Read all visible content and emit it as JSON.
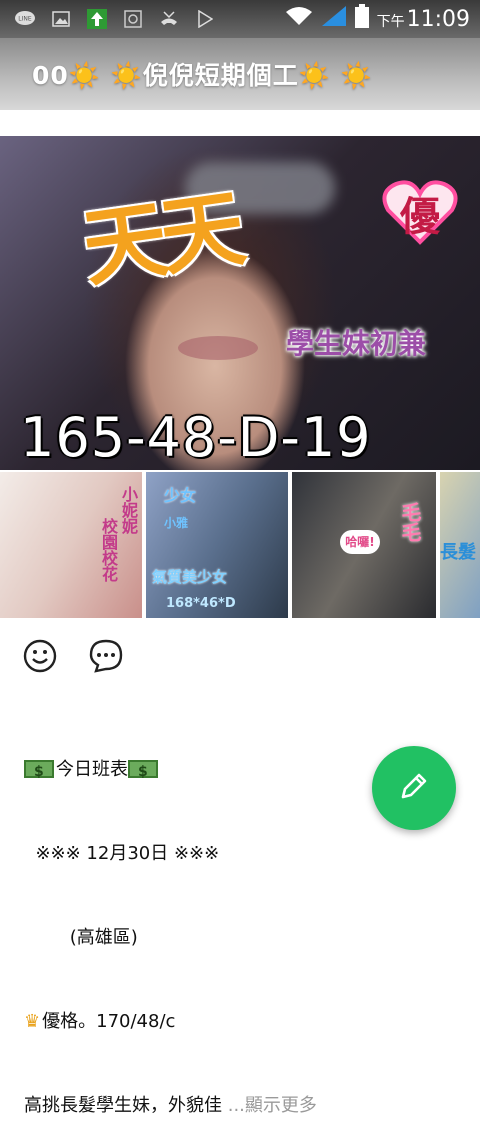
{
  "status_bar": {
    "icons": [
      "line-icon",
      "gallery-icon",
      "upload-icon",
      "sync-icon",
      "missed-call-icon",
      "play-store-icon"
    ],
    "time_prefix": "下午",
    "time": "11:09"
  },
  "header": {
    "title": "00☀️ ☀️倪倪短期個工☀️ ☀️"
  },
  "hero": {
    "big_text": "天天",
    "heart_text": "優",
    "tag": "學生妹初兼",
    "spec": "165-48-D-19"
  },
  "thumbnails": [
    {
      "labels": [
        "小妮妮",
        "校園校花"
      ]
    },
    {
      "labels": [
        "少女",
        "小雅",
        "氣質美少女",
        "168*46*D"
      ]
    },
    {
      "labels": [
        "毛毛"
      ],
      "bubble": "哈囉!"
    },
    {
      "labels": [
        "長髮"
      ]
    }
  ],
  "actions": {
    "like_icon": "smiley-icon",
    "comment_icon": "comment-icon"
  },
  "post": {
    "line1": "今日班表",
    "line2": "  ※※※ 12月30日 ※※※",
    "line3": "        (高雄區)",
    "line4": "優格。170/48/c",
    "line5": "高挑長髮學生妹，外貌佳 ",
    "more": "...顯示更多"
  },
  "fab": {
    "icon": "pencil-icon"
  }
}
